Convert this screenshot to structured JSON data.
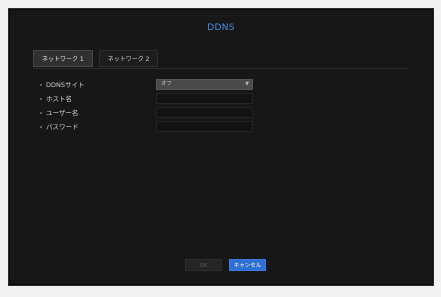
{
  "dialog": {
    "title": "DDNS"
  },
  "tabs": [
    {
      "label": "ネットワーク 1",
      "active": true
    },
    {
      "label": "ネットワーク 2",
      "active": false
    }
  ],
  "form": {
    "ddns_site": {
      "label": "DDNSサイト",
      "value": "オフ"
    },
    "host_name": {
      "label": "ホスト名",
      "value": ""
    },
    "user_name": {
      "label": "ユーザー名",
      "value": ""
    },
    "password": {
      "label": "パスワード",
      "value": ""
    }
  },
  "buttons": {
    "ok": "OK",
    "cancel": "キャンセル"
  },
  "colors": {
    "title": "#4b8fe5",
    "cancel_bg": "#2f6fd4",
    "dialog_bg": "#171717"
  }
}
